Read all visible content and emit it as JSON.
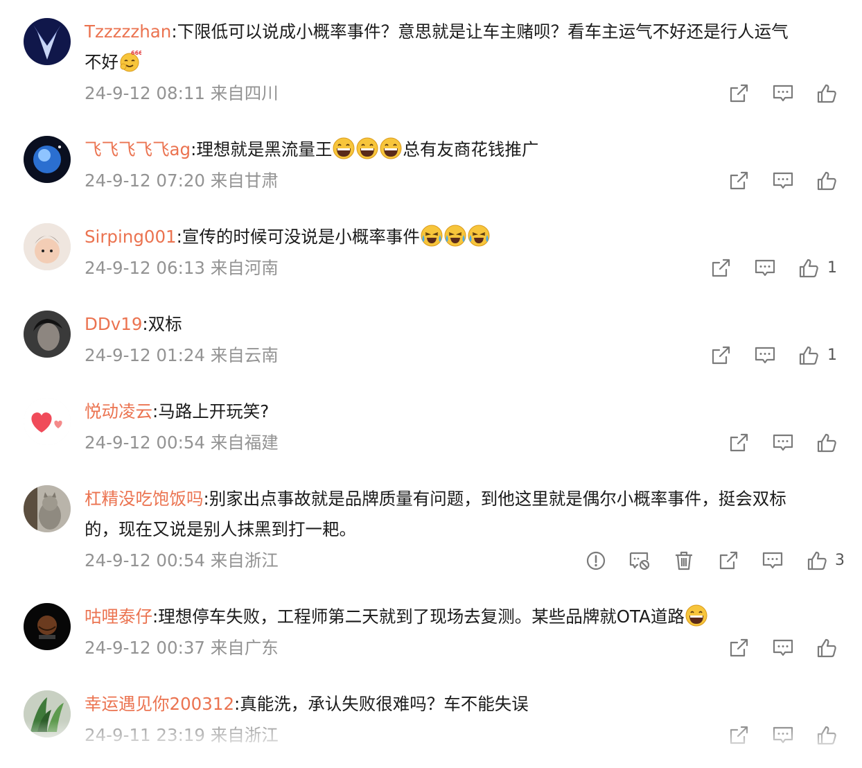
{
  "comments": [
    {
      "user": "Tzzzzzhan",
      "text": "下限低可以说成小概率事件？意思就是让车主赌呗？看车主运气不好还是行人运气",
      "text2": "不好",
      "time": "24-9-12 08:11 来自四川",
      "likes": "",
      "emoji": "666-face"
    },
    {
      "user": "飞飞飞飞飞ag",
      "text": "理想就是黑流量王",
      "text_after": "总有友商花钱推广",
      "time": "24-9-12 07:20 来自甘肃",
      "likes": "",
      "emoji": "grin-face"
    },
    {
      "user": "Sirping001",
      "text": "宣传的时候可没说是小概率事件",
      "time": "24-9-12 06:13 来自河南",
      "likes": "1",
      "emoji": "laugh-cry-face"
    },
    {
      "user": "DDv19",
      "text": "双标",
      "time": "24-9-12 01:24 来自云南",
      "likes": "1"
    },
    {
      "user": "悦动凌云",
      "text": "马路上开玩笑?",
      "time": "24-9-12 00:54 来自福建",
      "likes": ""
    },
    {
      "user": "杠精没吃饱饭吗",
      "text": "别家出点事故就是品牌质量有问题，到他这里就是偶尔小概率事件，挺会双标",
      "text2": "的，现在又说是别人抹黑到打一耙。",
      "time": "24-9-12 00:54 来自浙江",
      "likes": "3"
    },
    {
      "user": "咕哩泰仔",
      "text": "理想停车失败，工程师第二天就到了现场去复测。某些品牌就OTA道路",
      "time": "24-9-12 00:37 来自广东",
      "likes": "",
      "emoji": "grin-face"
    },
    {
      "user": "幸运遇见你200312",
      "text": "真能洗，承认失败很难吗？车不能失误",
      "time": "24-9-11 23:19 来自浙江",
      "likes": ""
    }
  ],
  "colors": {
    "username": "#eb7350",
    "meta": "#939393",
    "icon": "#7a7a7a"
  },
  "icons": [
    "share-icon",
    "comment-icon",
    "like-icon",
    "report-icon",
    "block-icon",
    "delete-icon"
  ]
}
